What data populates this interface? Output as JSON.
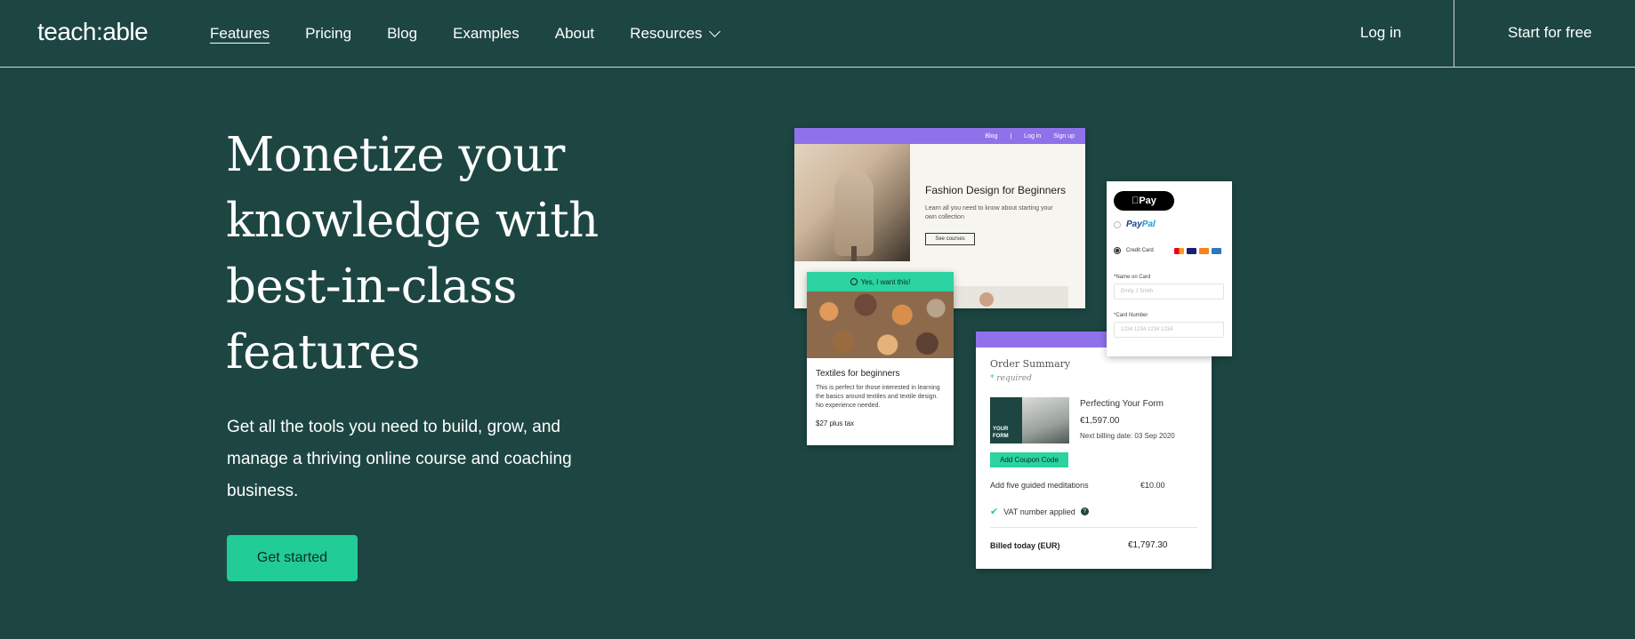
{
  "header": {
    "logo": "teach:able",
    "nav": [
      {
        "label": "Features"
      },
      {
        "label": "Pricing"
      },
      {
        "label": "Blog"
      },
      {
        "label": "Examples"
      },
      {
        "label": "About"
      },
      {
        "label": "Resources"
      }
    ],
    "login": "Log in",
    "start": "Start for free"
  },
  "hero": {
    "title": "Monetize your knowledge with best-in-class features",
    "subtitle": "Get all the tools you need to build, grow, and manage a thriving online course and coaching business.",
    "cta": "Get started"
  },
  "mock_course": {
    "nav": [
      "Blog",
      "|",
      "Log in",
      "Sign up"
    ],
    "title": "Fashion Design for Beginners",
    "desc": "Learn all you need to know about starting your own collection",
    "button": "See courses"
  },
  "mock_textile": {
    "banner": "Yes, I want this!",
    "title": "Textiles for beginners",
    "desc": "This is perfect for those interested in learning the basics around textiles and textile design. No experience needed.",
    "price": "$27 plus tax"
  },
  "mock_order": {
    "title": "Order Summary",
    "required_star": "*",
    "required": "required",
    "thumb_text": "YOUR FORM",
    "product": "Perfecting Your Form",
    "price": "€1,597.00",
    "next_billing": "Next billing date: 03 Sep 2020",
    "coupon": "Add Coupon Code",
    "addon_label": "Add five guided meditations",
    "addon_price": "€10.00",
    "vat": "VAT number applied",
    "billed_label": "Billed today (EUR)",
    "billed_total": "€1,797.30"
  },
  "mock_pay": {
    "applepay": " Pay",
    "paypal_1": "Pay",
    "paypal_2": "Pal",
    "credit_card": "Credit Card",
    "name_label": "*Name on Card",
    "name_placeholder": "Emily J Smith",
    "number_label": "*Card Number",
    "number_placeholder": "1234 1234 1234 1234"
  },
  "colors": {
    "background": "#1d4642",
    "accent_green": "#22cc97",
    "accent_purple": "#8f72ea"
  }
}
